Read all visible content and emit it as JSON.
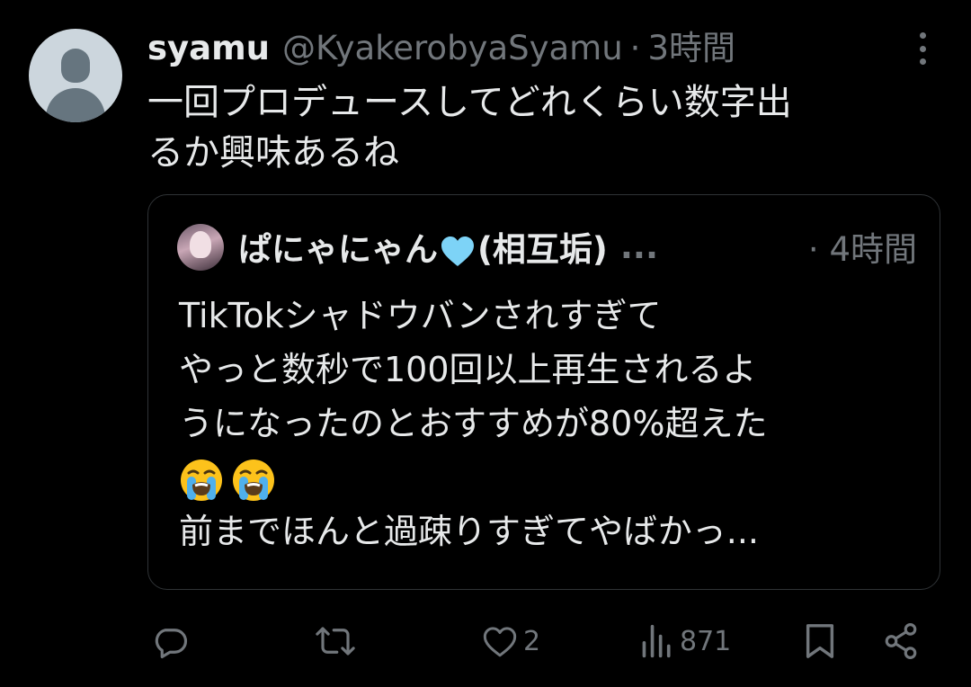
{
  "tweet": {
    "name": "syamu",
    "handle": "@KyakerobyaSyamu",
    "separator": "·",
    "time": "3時間",
    "text_lines": [
      "一回プロデュースしてどれくらい数字出",
      "るか興味あるね"
    ]
  },
  "quote": {
    "name_pre": "ぱにゃにゃん",
    "name_post": "(相互垢)",
    "ellipsis": "...",
    "separator": "·",
    "time": "4時間",
    "lines": [
      "TikTokシャドウバンされすぎて",
      "やっと数秒で100回以上再生されるよ",
      "うになったのとおすすめが80%超えた",
      "",
      "前までほんと過疎りすぎてやばかっ..."
    ],
    "emoji_icons": [
      "loudly-crying-face-icon",
      "loudly-crying-face-icon"
    ]
  },
  "actions": {
    "reply_count": "",
    "retweet_count": "",
    "like_count": "2",
    "views_count": "871"
  },
  "colors": {
    "background": "#000000",
    "text": "#e7e9ea",
    "secondary": "#71767b",
    "border": "#2f3336",
    "heart": "#7dd3f7"
  }
}
